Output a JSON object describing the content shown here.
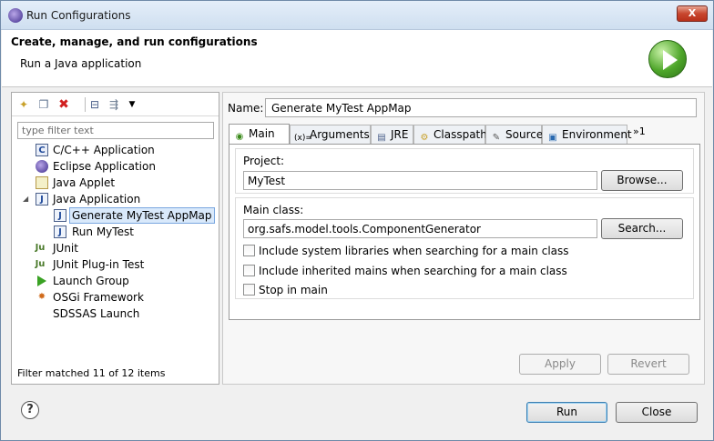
{
  "window": {
    "title": "Run Configurations",
    "close_label": "X"
  },
  "header": {
    "title": "Create, manage, and run configurations",
    "subtitle": "Run a Java application",
    "icon": "run-play-icon"
  },
  "left": {
    "toolbar": {
      "new": "new-config-icon",
      "duplicate": "duplicate-icon",
      "delete": "delete-icon",
      "collapse": "collapse-all-icon",
      "filter": "filter-icon",
      "menu": "dropdown-arrow-icon"
    },
    "filter_placeholder": "type filter text",
    "tree": [
      {
        "label": "C/C++ Application",
        "icon": "c-app-icon"
      },
      {
        "label": "Eclipse Application",
        "icon": "eclipse-icon"
      },
      {
        "label": "Java Applet",
        "icon": "java-applet-icon"
      },
      {
        "label": "Java Application",
        "icon": "java-app-icon",
        "expanded": true
      },
      {
        "label": "Generate MyTest AppMap",
        "icon": "java-app-icon",
        "selected": true
      },
      {
        "label": "Run MyTest",
        "icon": "java-app-icon"
      },
      {
        "label": "JUnit",
        "icon": "junit-icon"
      },
      {
        "label": "JUnit Plug-in Test",
        "icon": "junit-plugin-icon"
      },
      {
        "label": "Launch Group",
        "icon": "launch-group-icon"
      },
      {
        "label": "OSGi Framework",
        "icon": "osgi-icon"
      },
      {
        "label": "SDSSAS Launch",
        "icon": ""
      }
    ],
    "status": "Filter matched 11 of 12 items"
  },
  "right": {
    "name_label": "Name:",
    "name_value": "Generate MyTest AppMap",
    "tabs": [
      {
        "label": "Main",
        "icon": "main-tab-icon"
      },
      {
        "label": "Arguments",
        "icon": "arguments-icon"
      },
      {
        "label": "JRE",
        "icon": "jre-icon"
      },
      {
        "label": "Classpath",
        "icon": "classpath-icon"
      },
      {
        "label": "Source",
        "icon": "source-icon"
      },
      {
        "label": "Environment",
        "icon": "environment-icon"
      }
    ],
    "more_tabs": "»1",
    "project": {
      "label": "Project:",
      "value": "MyTest",
      "button": "Browse..."
    },
    "main_class": {
      "label": "Main class:",
      "value": "org.safs.model.tools.ComponentGenerator",
      "button": "Search..."
    },
    "checks": [
      {
        "label": "Include system libraries when searching for a main class",
        "checked": false
      },
      {
        "label": "Include inherited mains when searching for a main class",
        "checked": false
      },
      {
        "label": "Stop in main",
        "checked": false
      }
    ],
    "apply": "Apply",
    "revert": "Revert"
  },
  "footer": {
    "help": "?",
    "run": "Run",
    "close": "Close"
  }
}
